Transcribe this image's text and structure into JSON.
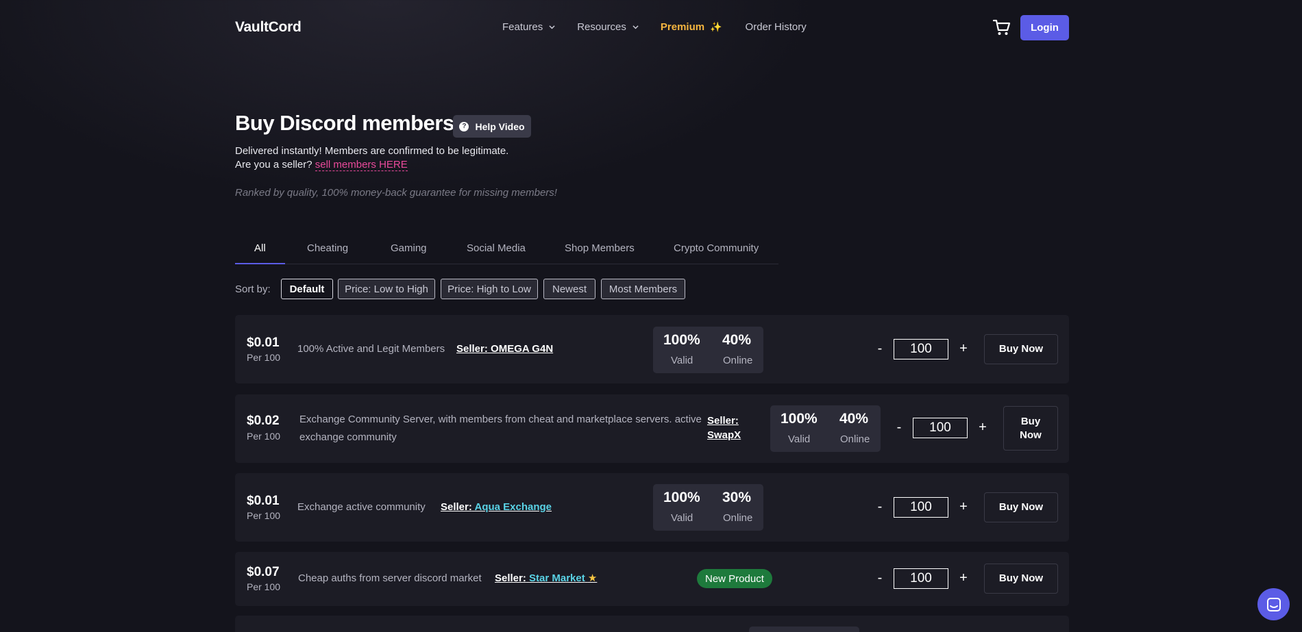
{
  "header": {
    "logo": "VaultCord",
    "nav": [
      {
        "label": "Features"
      },
      {
        "label": "Resources"
      },
      {
        "label": "Premium"
      },
      {
        "label": "Order History"
      }
    ],
    "login_label": "Login"
  },
  "hero": {
    "title": "Buy Discord members",
    "help_label": "Help Video",
    "subtitle": "Delivered instantly! Members are confirmed to be legitimate.",
    "seller_prompt": "Are you a seller?",
    "seller_link": "sell members HERE",
    "guarantee": "Ranked by quality, 100% money-back guarantee for missing members!"
  },
  "tabs": [
    "All",
    "Cheating",
    "Gaming",
    "Social Media",
    "Shop Members",
    "Crypto Community"
  ],
  "sort": {
    "label": "Sort by:",
    "options": [
      "Default",
      "Price: Low to High",
      "Price: High to Low",
      "Newest",
      "Most Members"
    ]
  },
  "listings": [
    {
      "price": "$0.01",
      "per": "Per 100",
      "description": "100% Active and Legit Members",
      "seller_prefix": "Seller:",
      "seller_name": "OMEGA G4N",
      "valid": "100%",
      "valid_label": "Valid",
      "online": "40%",
      "online_label": "Online",
      "qty": "100",
      "buy_label": "Buy Now"
    },
    {
      "price": "$0.02",
      "per": "Per 100",
      "description": "Exchange Community Server, with members from cheat and marketplace servers. active exchange community",
      "seller_prefix": "Seller:",
      "seller_name": "SwapX",
      "valid": "100%",
      "valid_label": "Valid",
      "online": "40%",
      "online_label": "Online",
      "qty": "100",
      "buy_label": "Buy Now"
    },
    {
      "price": "$0.01",
      "per": "Per 100",
      "description": "Exchange active community",
      "seller_prefix": "Seller:",
      "seller_name": "Aqua Exchange",
      "valid": "100%",
      "valid_label": "Valid",
      "online": "30%",
      "online_label": "Online",
      "qty": "100",
      "buy_label": "Buy Now"
    },
    {
      "price": "$0.07",
      "per": "Per 100",
      "description": "Cheap auths from server discord market",
      "seller_prefix": "Seller:",
      "seller_name": "Star Market",
      "badge": "New Product",
      "qty": "100",
      "buy_label": "Buy Now"
    }
  ],
  "qty_controls": {
    "minus": "-",
    "plus": "+"
  },
  "colors": {
    "accent": "#5b5ce6",
    "premium": "#f5b53f",
    "link_pink": "#e94a9b",
    "seller_cyan": "#5ad3e6",
    "badge_green": "#1e7a3c"
  }
}
